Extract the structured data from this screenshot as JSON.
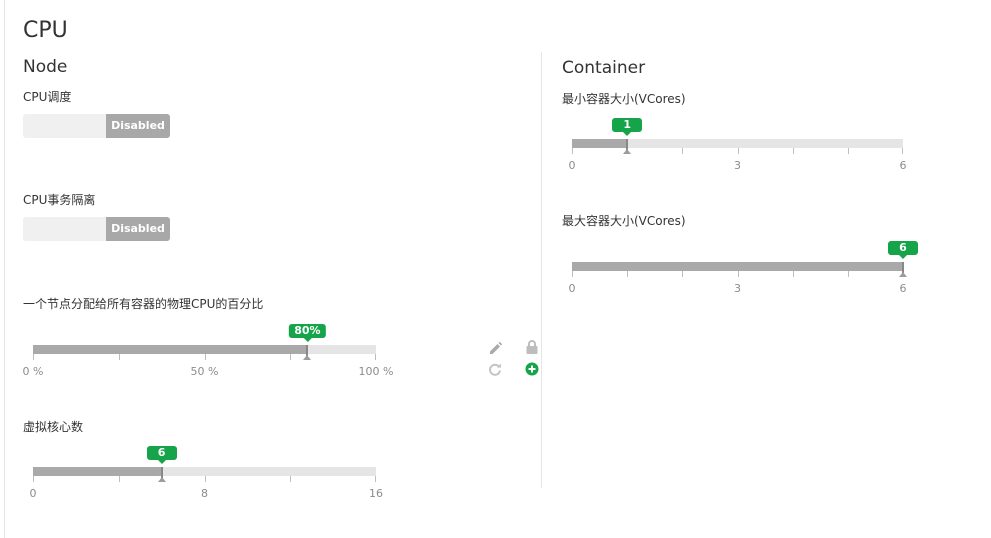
{
  "page": {
    "title": "CPU"
  },
  "node": {
    "heading": "Node",
    "cpu_scheduling": {
      "label": "CPU调度",
      "state": "Disabled"
    },
    "cpu_isolation": {
      "label": "CPU事务隔离",
      "state": "Disabled"
    },
    "cpu_percent": {
      "label": "一个节点分配给所有容器的物理CPU的百分比",
      "value": 80,
      "value_label": "80%",
      "min": 0,
      "max": 100,
      "tick_values": [
        0,
        25,
        50,
        75,
        100
      ],
      "tick_labels": [
        "0 %",
        "50 %",
        "100 %"
      ],
      "tick_label_values": [
        0,
        50,
        100
      ]
    },
    "vcores": {
      "label": "虚拟核心数",
      "value": 6,
      "value_label": "6",
      "min": 0,
      "max": 16,
      "tick_values": [
        0,
        4,
        8,
        12,
        16
      ],
      "tick_labels": [
        "0",
        "8",
        "16"
      ],
      "tick_label_values": [
        0,
        8,
        16
      ]
    }
  },
  "actions": {
    "edit_icon": "pencil-icon",
    "lock_icon": "lock-icon",
    "refresh_icon": "refresh-icon",
    "add_icon": "plus-circle-icon"
  },
  "container": {
    "heading": "Container",
    "min_size": {
      "label": "最小容器大小(VCores)",
      "value": 1,
      "value_label": "1",
      "min": 0,
      "max": 6,
      "tick_values": [
        0,
        1,
        2,
        3,
        4,
        5,
        6
      ],
      "tick_labels": [
        "0",
        "3",
        "6"
      ],
      "tick_label_values": [
        0,
        3,
        6
      ]
    },
    "max_size": {
      "label": "最大容器大小(VCores)",
      "value": 6,
      "value_label": "6",
      "min": 0,
      "max": 6,
      "tick_values": [
        0,
        1,
        2,
        3,
        4,
        5,
        6
      ],
      "tick_labels": [
        "0",
        "3",
        "6"
      ],
      "tick_label_values": [
        0,
        3,
        6
      ]
    }
  },
  "colors": {
    "accent": "#16a44a",
    "fill": "#a9a9a9",
    "track": "#e5e5e5"
  }
}
